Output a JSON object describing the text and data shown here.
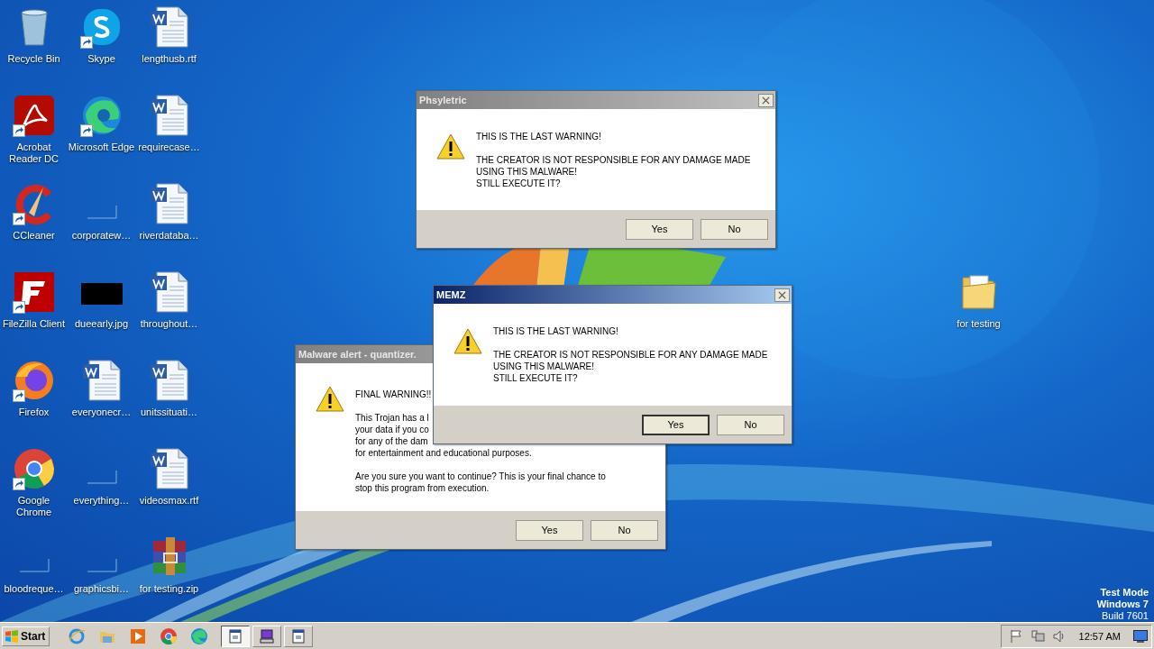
{
  "desktop_icons": [
    {
      "label": "Recycle Bin",
      "kind": "recycle",
      "shortcut": false
    },
    {
      "label": "Acrobat Reader DC",
      "kind": "acrobat",
      "shortcut": true
    },
    {
      "label": "CCleaner",
      "kind": "ccleaner",
      "shortcut": true
    },
    {
      "label": "FileZilla Client",
      "kind": "filezilla",
      "shortcut": true
    },
    {
      "label": "Firefox",
      "kind": "firefox",
      "shortcut": true
    },
    {
      "label": "Google Chrome",
      "kind": "chrome",
      "shortcut": true
    },
    {
      "label": "bloodreque…",
      "kind": "blank",
      "shortcut": false
    },
    {
      "label": "Skype",
      "kind": "skype",
      "shortcut": true
    },
    {
      "label": "Microsoft Edge",
      "kind": "edge",
      "shortcut": true
    },
    {
      "label": "corporatew…",
      "kind": "blank",
      "shortcut": false
    },
    {
      "label": "dueearly.jpg",
      "shortcut": false
    },
    {
      "label": "everyonecr…",
      "kind": "word",
      "shortcut": false
    },
    {
      "label": "everything…",
      "kind": "blank",
      "shortcut": false
    },
    {
      "label": "graphicsbi…",
      "kind": "blank",
      "shortcut": false
    },
    {
      "label": "lengthusb.rtf",
      "kind": "word",
      "shortcut": false
    },
    {
      "label": "requirecase…",
      "kind": "word",
      "shortcut": false
    },
    {
      "label": "riverdataba…",
      "kind": "word",
      "shortcut": false
    },
    {
      "label": "throughout…",
      "kind": "word",
      "shortcut": false
    },
    {
      "label": "unitssituati…",
      "kind": "word",
      "shortcut": false
    },
    {
      "label": "videosmax.rtf",
      "kind": "word",
      "shortcut": false
    },
    {
      "label": "for testing.zip",
      "kind": "archive",
      "shortcut": false
    }
  ],
  "folder_icon": {
    "label": "for testing"
  },
  "dialogs": [
    {
      "title": "Phsyletric",
      "active": false,
      "close_button": true,
      "paragraphs": [
        [
          "THIS IS THE LAST WARNING!"
        ],
        [
          "THE CREATOR IS NOT RESPONSIBLE FOR ANY DAMAGE MADE",
          "USING THIS MALWARE!",
          "STILL EXECUTE IT?"
        ]
      ],
      "buttons": [
        {
          "label": "Yes",
          "default": false
        },
        {
          "label": "No",
          "default": false
        }
      ]
    },
    {
      "title": "Malware alert - quantizer.",
      "active": false,
      "paragraphs": [
        [
          "FINAL WARNING!!"
        ],
        [
          "This Trojan has a l",
          "your data if you co",
          "for any of the dam",
          "for entertainment and educational purposes."
        ],
        [
          "Are you sure you want to continue? This is your final chance to",
          "stop this program from execution."
        ]
      ],
      "buttons": [
        {
          "label": "Yes",
          "default": false
        },
        {
          "label": "No",
          "default": false
        }
      ]
    },
    {
      "title": "MEMZ",
      "active": true,
      "close_button": true,
      "paragraphs": [
        [
          "THIS IS THE LAST WARNING!"
        ],
        [
          "THE CREATOR IS NOT RESPONSIBLE FOR ANY DAMAGE MADE",
          "USING THIS MALWARE!",
          "STILL EXECUTE IT?"
        ]
      ],
      "buttons": [
        {
          "label": "Yes",
          "default": true
        },
        {
          "label": "No",
          "default": false
        }
      ]
    }
  ],
  "watermark_os": [
    "Test Mode",
    "Windows 7",
    "Build 7601"
  ],
  "taskbar": {
    "start": "Start",
    "quick_launch": [
      {
        "kind": "ie"
      },
      {
        "kind": "explorer"
      },
      {
        "kind": "media"
      },
      {
        "kind": "chrome"
      },
      {
        "kind": "edge"
      }
    ],
    "tasks": [
      {
        "kind": "window",
        "selected": true
      },
      {
        "kind": "computer",
        "selected": false
      },
      {
        "kind": "window",
        "selected": false
      }
    ],
    "tray": [
      {
        "kind": "flag"
      },
      {
        "kind": "network"
      },
      {
        "kind": "volume"
      }
    ],
    "clock": "12:57 AM"
  }
}
